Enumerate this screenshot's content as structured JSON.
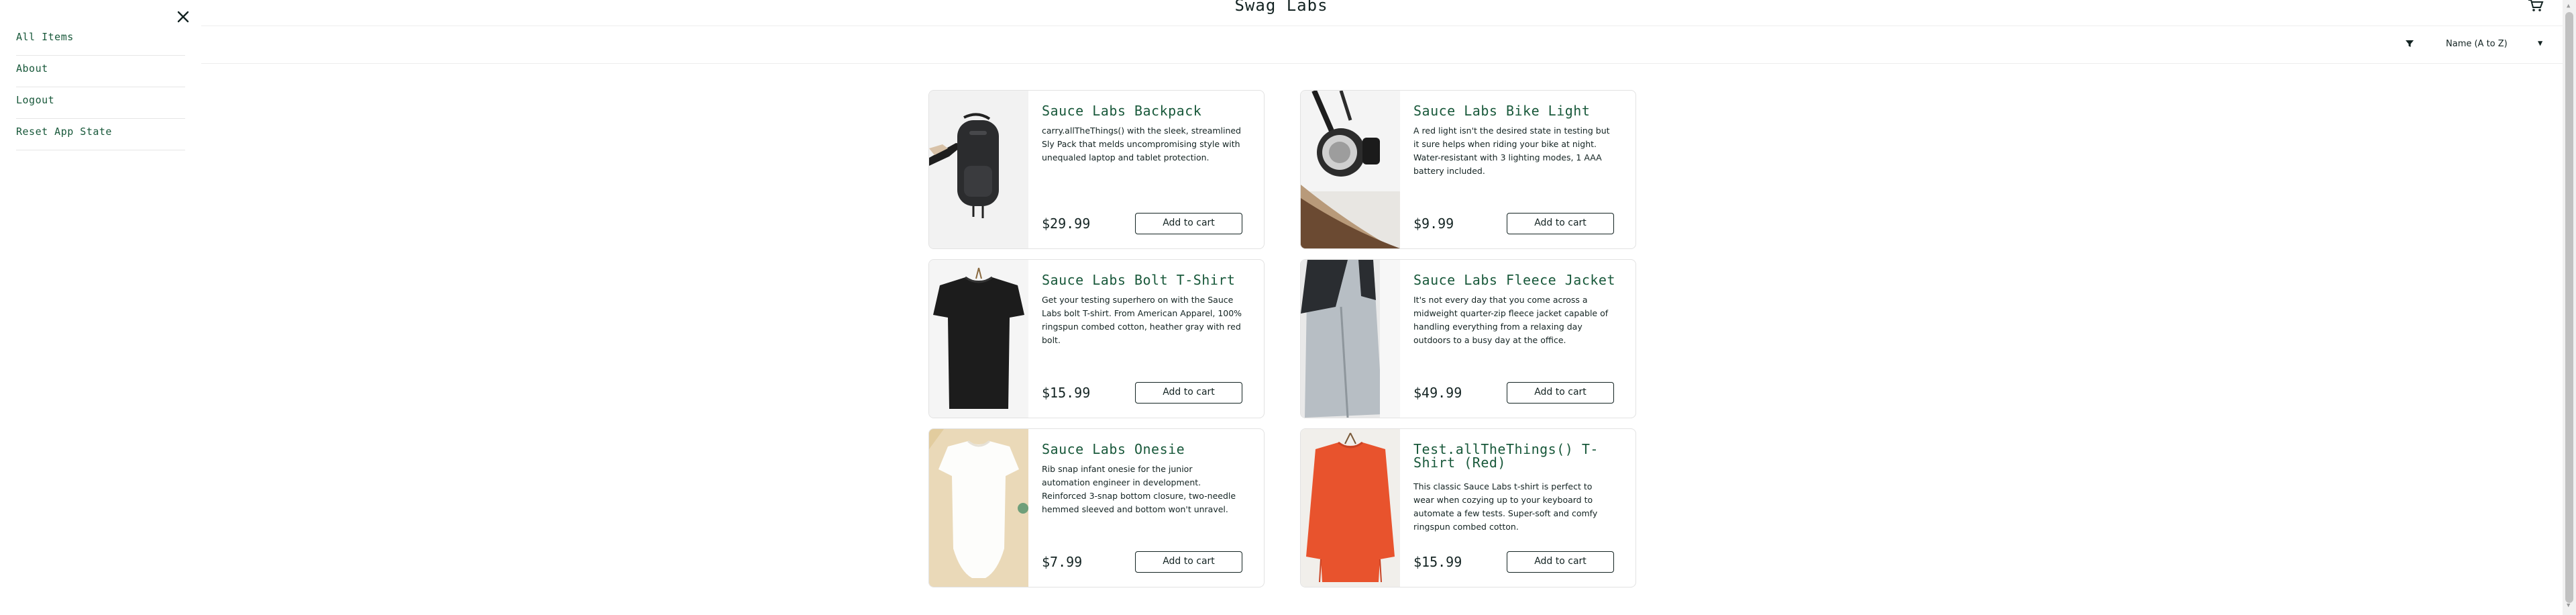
{
  "header": {
    "app_title": "Swag Labs"
  },
  "sort": {
    "selected": "Name (A to Z)"
  },
  "menu": {
    "items": [
      {
        "label": "All Items"
      },
      {
        "label": "About"
      },
      {
        "label": "Logout"
      },
      {
        "label": "Reset App State"
      }
    ]
  },
  "products": [
    {
      "name": "Sauce Labs Backpack",
      "description": "carry.allTheThings() with the sleek, streamlined Sly Pack that melds uncompromising style with unequaled laptop and tablet protection.",
      "price": "$29.99",
      "button": "Add to cart"
    },
    {
      "name": "Sauce Labs Bike Light",
      "description": "A red light isn't the desired state in testing but it sure helps when riding your bike at night. Water-resistant with 3 lighting modes, 1 AAA battery included.",
      "price": "$9.99",
      "button": "Add to cart"
    },
    {
      "name": "Sauce Labs Bolt T-Shirt",
      "description": "Get your testing superhero on with the Sauce Labs bolt T-shirt. From American Apparel, 100% ringspun combed cotton, heather gray with red bolt.",
      "price": "$15.99",
      "button": "Add to cart"
    },
    {
      "name": "Sauce Labs Fleece Jacket",
      "description": "It's not every day that you come across a midweight quarter-zip fleece jacket capable of handling everything from a relaxing day outdoors to a busy day at the office.",
      "price": "$49.99",
      "button": "Add to cart"
    },
    {
      "name": "Sauce Labs Onesie",
      "description": "Rib snap infant onesie for the junior automation engineer in development. Reinforced 3-snap bottom closure, two-needle hemmed sleeved and bottom won't unravel.",
      "price": "$7.99",
      "button": "Add to cart"
    },
    {
      "name": "Test.allTheThings() T-Shirt (Red)",
      "description": "This classic Sauce Labs t-shirt is perfect to wear when cozying up to your keyboard to automate a few tests. Super-soft and comfy ringspun combed cotton.",
      "price": "$15.99",
      "button": "Add to cart"
    }
  ],
  "colors": {
    "brand_green": "#18583a",
    "text": "#132322",
    "border": "#e2e2e2"
  }
}
